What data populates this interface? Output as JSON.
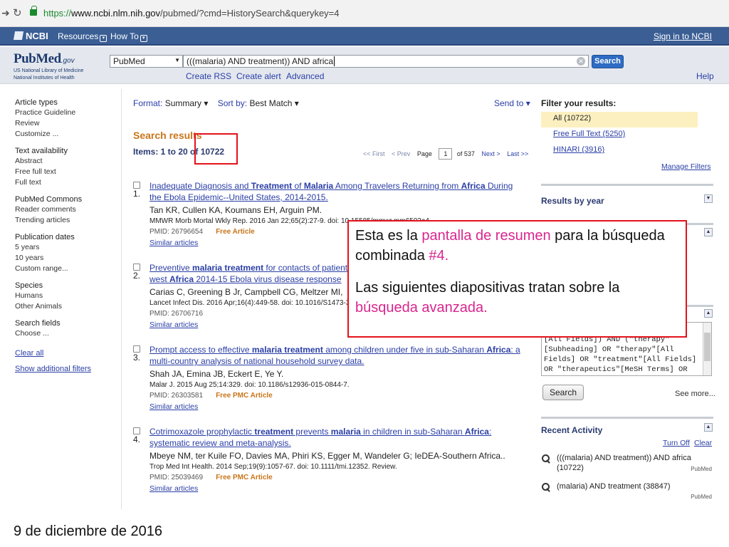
{
  "browser": {
    "url_scheme": "https://",
    "url_host": "www.ncbi.nlm.nih.gov",
    "url_path": "/pubmed/?cmd=HistorySearch&querykey=4"
  },
  "ncbi_bar": {
    "logo": "NCBI",
    "resources": "Resources",
    "howto": "How To",
    "signin": "Sign in to NCBI"
  },
  "header": {
    "logo_word": "PubMed",
    "logo_gov": ".gov",
    "logo_sub1": "US National Library of Medicine",
    "logo_sub2": "National Institutes of Health",
    "database": "PubMed",
    "query": "(((malaria) AND treatment)) AND africa",
    "search_button": "Search",
    "create_rss": "Create RSS",
    "create_alert": "Create alert",
    "advanced": "Advanced",
    "help": "Help"
  },
  "sidebar": {
    "groups": [
      {
        "head": "Article types",
        "items": [
          "Practice Guideline",
          "Review",
          "Customize ..."
        ]
      },
      {
        "head": "Text availability",
        "items": [
          "Abstract",
          "Free full text",
          "Full text"
        ]
      },
      {
        "head": "PubMed Commons",
        "items": [
          "Reader comments",
          "Trending articles"
        ]
      },
      {
        "head": "Publication dates",
        "items": [
          "5 years",
          "10 years",
          "Custom range..."
        ]
      },
      {
        "head": "Species",
        "items": [
          "Humans",
          "Other Animals"
        ]
      },
      {
        "head": "Search fields",
        "items": [
          "Choose ..."
        ]
      }
    ],
    "clear_all": "Clear all",
    "show_filters": "Show additional filters"
  },
  "toolbar": {
    "format_label": "Format:",
    "format_value": "Summary",
    "sort_label": "Sort by:",
    "sort_value": "Best Match",
    "send_to": "Send to"
  },
  "results": {
    "heading": "Search results",
    "items_text": "Items: 1 to 20 of 10722",
    "pager": {
      "first": "<< First",
      "prev": "< Prev",
      "page_label": "Page",
      "page": "1",
      "of": "of 537",
      "next": "Next >",
      "last": "Last >>"
    },
    "list": [
      {
        "num": "1.",
        "title_html": "Inadequate Diagnosis and <b>Treatment</b> of <b>Malaria</b> Among Travelers Returning from <b>Africa</b> During the Ebola Epidemic--United States, 2014-2015.",
        "authors": "Tan KR, Cullen KA, Koumans EH, Arguin PM.",
        "journal": "MMWR Morb Mortal Wkly Rep. 2016 Jan 22;65(2):27-9. doi: 10.15585/mmwr.mm6502a4.",
        "pmid": "PMID: 26796654",
        "free": "Free Article",
        "similar": "Similar articles"
      },
      {
        "num": "2.",
        "title_html": "Preventive <b>malaria treatment</b> for contacts of patients with Ebola virus disease in the context of the west <b>Africa</b> 2014-15 Ebola virus disease response",
        "authors": "Carias C, Greening B Jr, Campbell CG, Meltzer MI,",
        "journal": "Lancet Infect Dis. 2016 Apr;16(4):449-58. doi: 10.1016/S1473-3099(15)00465-X.",
        "pmid": "PMID: 26706716",
        "free": "",
        "similar": "Similar articles"
      },
      {
        "num": "3.",
        "title_html": "Prompt access to effective <b>malaria treatment</b> among children under five in sub-Saharan <b>Africa</b>: a multi-country analysis of national household survey data.",
        "authors": "Shah JA, Emina JB, Eckert E, Ye Y.",
        "journal": "Malar J. 2015 Aug 25;14:329. doi: 10.1186/s12936-015-0844-7.",
        "pmid": "PMID: 26303581",
        "free": "Free PMC Article",
        "similar": "Similar articles"
      },
      {
        "num": "4.",
        "title_html": "Cotrimoxazole prophylactic <b>treatment</b> prevents <b>malaria</b> in children in sub-Saharan <b>Africa</b>: systematic review and meta-analysis.",
        "authors": "Mbeye NM, ter Kuile FO, Davies MA, Phiri KS, Egger M, Wandeler G; IeDEA-Southern Africa..",
        "journal": "Trop Med Int Health. 2014 Sep;19(9):1057-67. doi: 10.1111/tmi.12352. Review.",
        "pmid": "PMID: 25039469",
        "free": "Free PMC Article",
        "similar": "Similar articles"
      }
    ]
  },
  "right": {
    "filter_head": "Filter your results:",
    "filter_all": "All (10722)",
    "filter_free": "Free Full Text (5250)",
    "filter_hinari": "HINARI (3916)",
    "manage": "Manage Filters",
    "results_by_year": "Results by year",
    "query_text": "a\"\n[All Fields]) AND (\"therapy\"\n[Subheading] OR \"therapy\"[All\nFields] OR \"treatment\"[All Fields]\nOR \"therapeutics\"[MeSH Terms] OR",
    "query_search": "Search",
    "see_more": "See more...",
    "recent_head": "Recent Activity",
    "turn_off": "Turn Off",
    "clear": "Clear",
    "activity": [
      {
        "text": "(((malaria) AND treatment)) AND africa (10722)",
        "src": "PubMed"
      },
      {
        "text": "(malaria) AND treatment (38847)",
        "src": "PubMed"
      }
    ]
  },
  "callout": {
    "p1_a": "Esta es la ",
    "p1_hl": "pantalla de resumen",
    "p1_b": " para  la búsqueda combinada ",
    "p1_num": "#4.",
    "p2_a": "Las siguientes diapositivas tratan sobre la ",
    "p2_hl": "búsqueda avanzada."
  },
  "footer": {
    "date": "9 de diciembre de 2016"
  },
  "colors": {
    "ncbi_blue": "#3b5e94",
    "callout_border": "#e3121b",
    "highlight": "#d9268f",
    "filter_selected": "#fdf0c0"
  }
}
